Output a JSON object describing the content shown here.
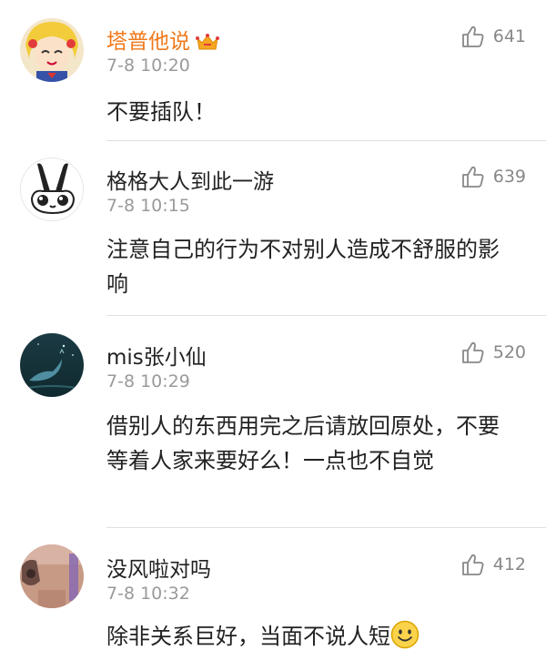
{
  "comments": [
    {
      "username": "塔普他说",
      "vip": true,
      "time": "7-8 10:20",
      "likes": "641",
      "text": "不要插队！"
    },
    {
      "username": "格格大人到此一游",
      "vip": false,
      "time": "7-8 10:15",
      "likes": "639",
      "text": "注意自己的行为不对别人造成不舒服的影响"
    },
    {
      "username": "mis张小仙",
      "vip": false,
      "time": "7-8 10:29",
      "likes": "520",
      "text": "借别人的东西用完之后请放回原处，不要等着人家来要好么！一点也不自觉"
    },
    {
      "username": "没风啦对吗",
      "vip": false,
      "time": "7-8 10:32",
      "likes": "412",
      "text": "除非关系巨好，当面不说人短"
    }
  ],
  "icons": {
    "like": "thumbs-up-icon",
    "vip": "crown-icon",
    "emoji": "smile-emoji-icon"
  },
  "colors": {
    "vip_name": "#f07a1c",
    "name": "#222222",
    "meta": "#9a9a9a",
    "divider": "#e0e0e0"
  }
}
